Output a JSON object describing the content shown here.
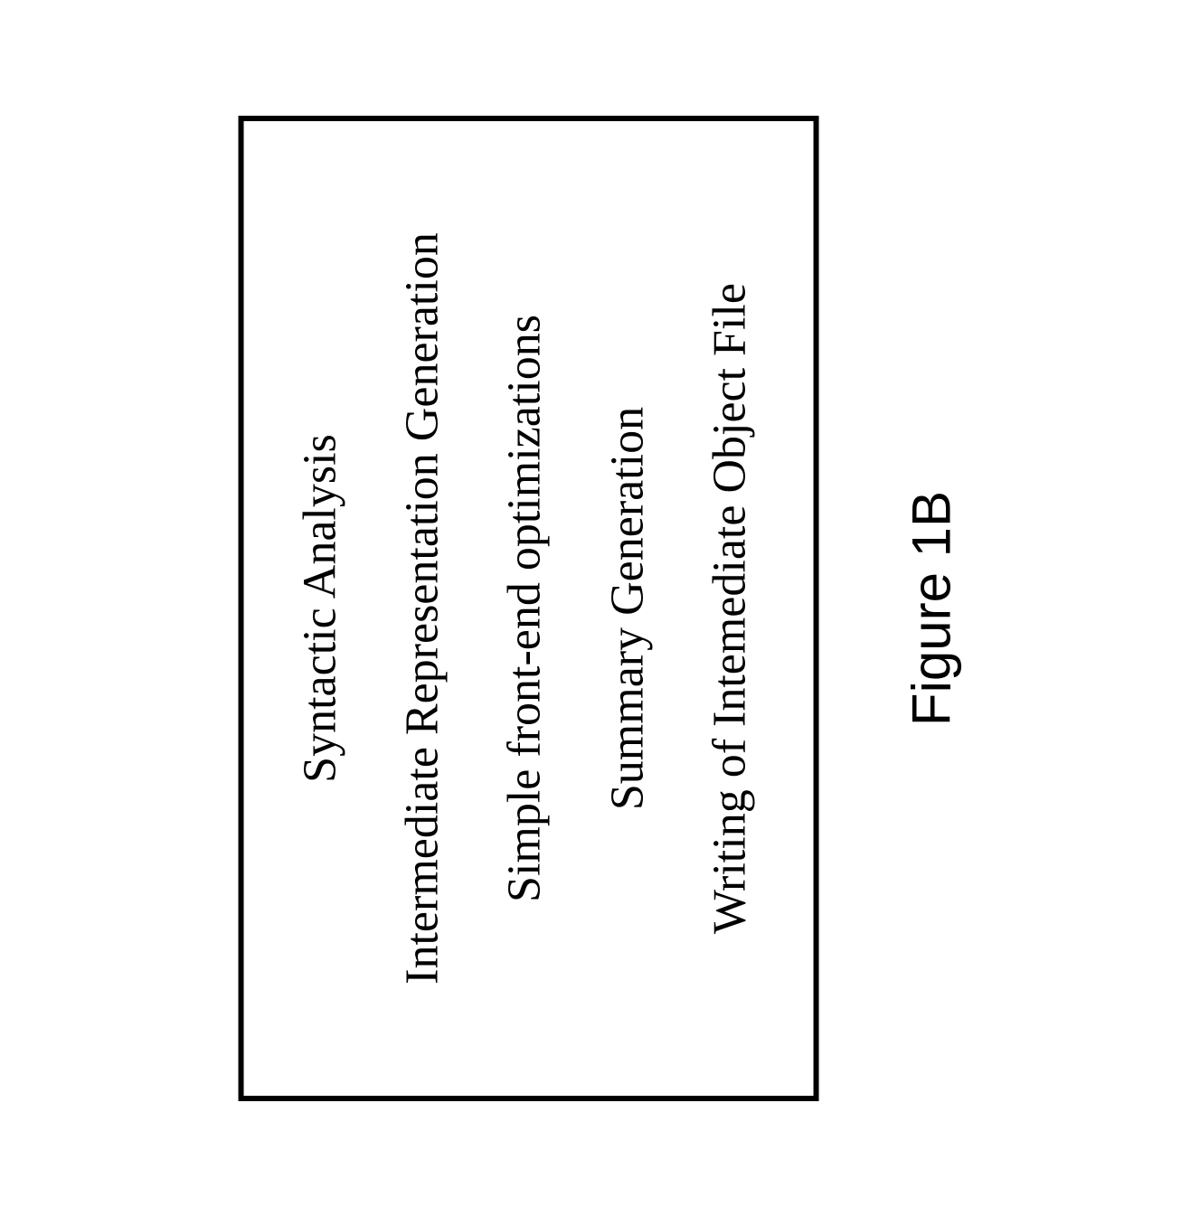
{
  "figure": {
    "caption": "Figure 1B",
    "box_items": [
      "Syntactic Analysis",
      "Intermediate Representation Generation",
      "Simple front-end optimizations",
      "Summary Generation",
      "Writing of Intemediate Object File"
    ]
  }
}
